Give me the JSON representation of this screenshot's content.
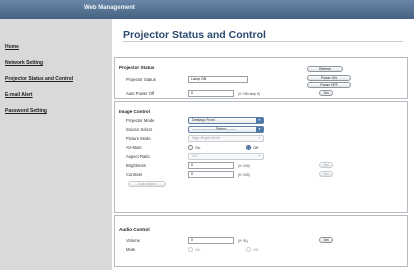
{
  "header": {
    "title": "Web Management"
  },
  "sidebar": {
    "items": [
      {
        "label": "Home"
      },
      {
        "label": "Network Setting"
      },
      {
        "label": "Projector Status and Control"
      },
      {
        "label": "E-mail Alert"
      },
      {
        "label": "Password Setting"
      }
    ]
  },
  "page": {
    "title": "Projector Status and Control"
  },
  "status": {
    "heading": "Projector Status",
    "refresh_label": "Refresh",
    "projector_status_label": "Projector Status",
    "projector_status_value": "Lamp ON",
    "power_on_label": "Power ON",
    "power_off_label": "Power OFF",
    "auto_power_off_label": "Auto Power Off",
    "auto_power_off_value": "0",
    "auto_power_off_hint": "(0~180 step 5)",
    "set_label": "Set"
  },
  "image": {
    "heading": "Image Control",
    "projector_mode_label": "Projector Mode",
    "projector_mode_value": "Desktop Front",
    "source_select_label": "Source Select",
    "source_select_value": "--------------------Select--------",
    "picture_mode_label": "Picture Mode",
    "picture_mode_value": "High-Bright Mode",
    "av_mute_label": "AV-Mute",
    "av_mute_on": "On",
    "av_mute_off": "Off",
    "aspect_ratio_label": "Aspect Ratio",
    "aspect_ratio_value": "4:3",
    "brightness_label": "Brightness",
    "brightness_value": "0",
    "brightness_hint": "(0~100)",
    "contrast_label": "Contrast",
    "contrast_value": "0",
    "contrast_hint": "(0~100)",
    "set_label": "Set",
    "auto_adjust_label": "Auto Adjust"
  },
  "audio": {
    "heading": "Audio Control",
    "volume_label": "Volume",
    "volume_value": "0",
    "volume_hint": "(0~31)",
    "mute_label": "Mute",
    "mute_on": "On",
    "mute_off": "Off",
    "set_label": "Set"
  }
}
